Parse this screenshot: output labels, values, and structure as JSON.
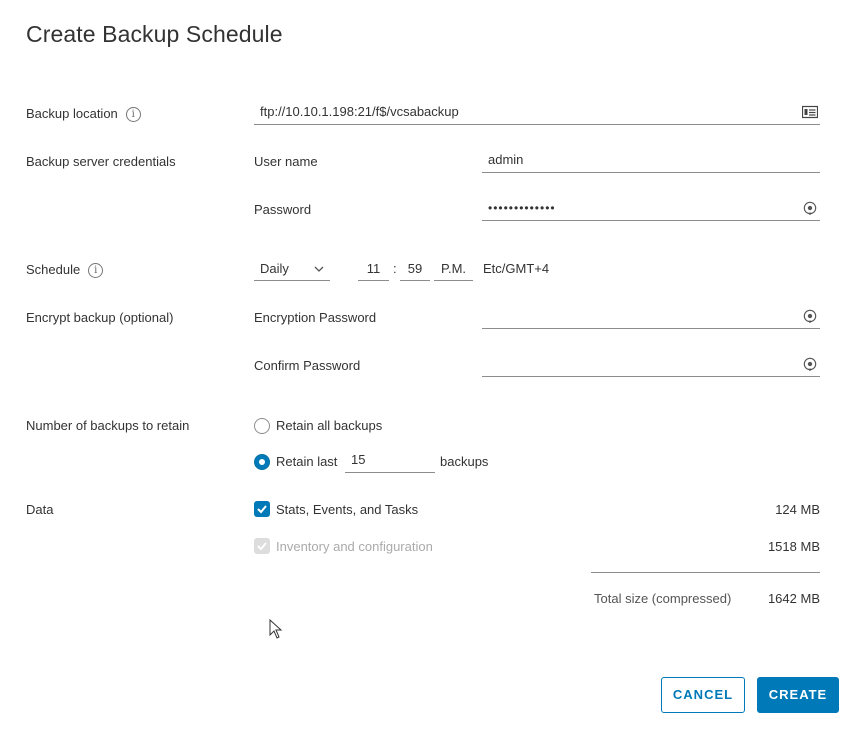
{
  "dialog": {
    "title": "Create Backup Schedule"
  },
  "backup_location": {
    "label": "Backup location",
    "value": "ftp://10.10.1.198:21/f$/vcsabackup"
  },
  "credentials": {
    "label": "Backup server credentials",
    "username_label": "User name",
    "username_value": "admin",
    "password_label": "Password",
    "password_value": "•••••••••••••"
  },
  "schedule": {
    "label": "Schedule",
    "frequency": "Daily",
    "hour": "11",
    "separator": ":",
    "minute": "59",
    "ampm": "P.M.",
    "timezone": "Etc/GMT+4"
  },
  "encrypt": {
    "label": "Encrypt backup (optional)",
    "enc_password_label": "Encryption Password",
    "confirm_password_label": "Confirm Password"
  },
  "retain": {
    "label": "Number of backups to retain",
    "option_all": "Retain all backups",
    "option_last": "Retain last",
    "last_count": "15",
    "backups_suffix": "backups",
    "selected": "last"
  },
  "data": {
    "label": "Data",
    "items": [
      {
        "label": "Stats, Events, and Tasks",
        "size": "124 MB",
        "checked": true,
        "disabled": false
      },
      {
        "label": "Inventory and configuration",
        "size": "1518 MB",
        "checked": true,
        "disabled": true
      }
    ],
    "total_label": "Total size (compressed)",
    "total_value": "1642 MB"
  },
  "buttons": {
    "cancel": "CANCEL",
    "create": "CREATE"
  },
  "icons": {
    "info": "info-icon",
    "browse": "browse-icon",
    "reveal_password": "eye-icon",
    "dropdown": "chevron-down-icon",
    "check": "checkmark-icon",
    "cursor": "mouse-pointer-icon"
  },
  "colors": {
    "accent": "#0079b8",
    "text": "#333333",
    "border": "#8c8c8c",
    "disabled": "#dddddd"
  }
}
